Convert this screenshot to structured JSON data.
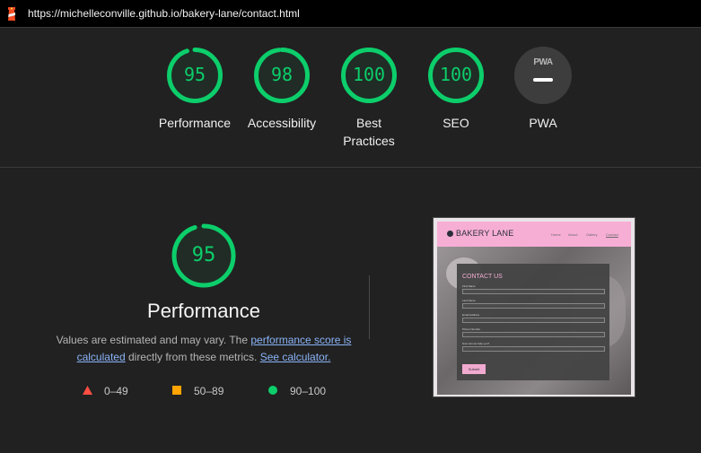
{
  "url": "https://michelleconville.github.io/bakery-lane/contact.html",
  "colors": {
    "pass": "#0cce6b",
    "average": "#ffa400",
    "fail": "#ff4e42",
    "link": "#8ab4f8"
  },
  "categories": [
    {
      "label": "Performance",
      "score": "95",
      "score_value": 95
    },
    {
      "label": "Accessibility",
      "score": "98",
      "score_value": 98
    },
    {
      "label": "Best Practices",
      "score": "100",
      "score_value": 100
    },
    {
      "label": "SEO",
      "score": "100",
      "score_value": 100
    },
    {
      "label": "PWA",
      "badge": "PWA"
    }
  ],
  "performance": {
    "score": "95",
    "score_value": 95,
    "title": "Performance",
    "desc_prefix": "Values are estimated and may vary. The ",
    "link_score": "performance score is calculated",
    "desc_middle": " directly from these metrics. ",
    "link_calculator": "See calculator."
  },
  "legend": [
    {
      "icon": "triangle-icon",
      "range": "0–49"
    },
    {
      "icon": "square-icon",
      "range": "50–89"
    },
    {
      "icon": "circle-icon",
      "range": "90–100"
    }
  ],
  "screenshot": {
    "brand": "BAKERY LANE",
    "nav": [
      "Home",
      "About",
      "Gallery",
      "Contact"
    ],
    "form_title": "CONTACT US",
    "fields": [
      "First Name",
      "Last Name",
      "Email Address",
      "Phone Number",
      "How can we help you?"
    ],
    "submit": "Submit"
  }
}
